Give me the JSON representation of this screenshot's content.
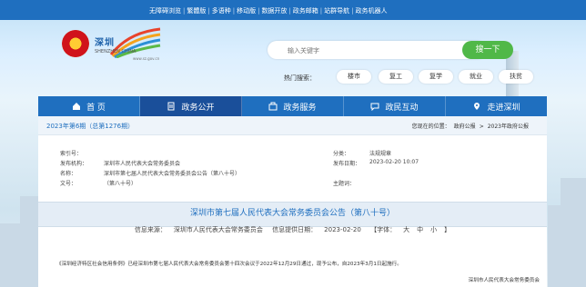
{
  "topbar": {
    "links": [
      "无障碍浏览",
      "繁體版",
      "多语种",
      "移动版",
      "数据开放",
      "政务邮箱",
      "站群导航",
      "政务机器人"
    ]
  },
  "header": {
    "logo_text": "深圳",
    "logo_sub": "SHENZHEN CHINA",
    "logo_url": "www.sz.gov.cn"
  },
  "search": {
    "placeholder": "输入关键字",
    "button": "搜一下",
    "hot_label": "热门搜索：",
    "hot_tags": [
      "楼市",
      "复工",
      "复学",
      "就业",
      "扶贫"
    ]
  },
  "nav": {
    "items": [
      {
        "label": "首 页",
        "icon": "home-icon"
      },
      {
        "label": "政务公开",
        "icon": "document-icon"
      },
      {
        "label": "政务服务",
        "icon": "service-icon"
      },
      {
        "label": "政民互动",
        "icon": "chat-icon"
      },
      {
        "label": "走进深圳",
        "icon": "location-icon"
      }
    ],
    "active_index": 1
  },
  "issue": {
    "label": "2023年第6期（总第1276期）",
    "breadcrumb_prefix": "您现在的位置：",
    "breadcrumb": [
      "政府公报",
      "2023年政府公报"
    ]
  },
  "meta": {
    "index_label": "索引号：",
    "index_value": "",
    "category_label": "分类：",
    "category_value": "法规规章",
    "agency_label": "发布机构：",
    "agency_value": "深圳市人民代表大会常务委员会",
    "date_label": "发布日期：",
    "date_value": "2023-02-20 10:07",
    "name_label": "名称：",
    "name_value": "深圳市第七届人民代表大会常务委员会公告（第八十号）",
    "docno_label": "文号：",
    "docno_value": "（第八十号）",
    "subject_label": "主题词：",
    "subject_value": ""
  },
  "document": {
    "title": "深圳市第七届人民代表大会常务委员会公告（第八十号）",
    "source_label": "信息来源：",
    "source_value": "深圳市人民代表大会常务委员会",
    "provided_label": "信息提供日期：",
    "provided_value": "2023-02-20",
    "font_label": "【字体：",
    "font_sizes": [
      "大",
      "中",
      "小"
    ],
    "font_close": "】",
    "body": "《深圳经济特区社会信用条例》已经深圳市第七届人民代表大会常务委员会第十四次会议于2022年12月29日通过，现予公布，自2023年3月1日起施行。",
    "signature": "深圳市人民代表大会常务委员会"
  },
  "colors": {
    "primary": "#1f6fbf",
    "nav_active": "#1a4f9a",
    "search_button": "#50b848"
  }
}
